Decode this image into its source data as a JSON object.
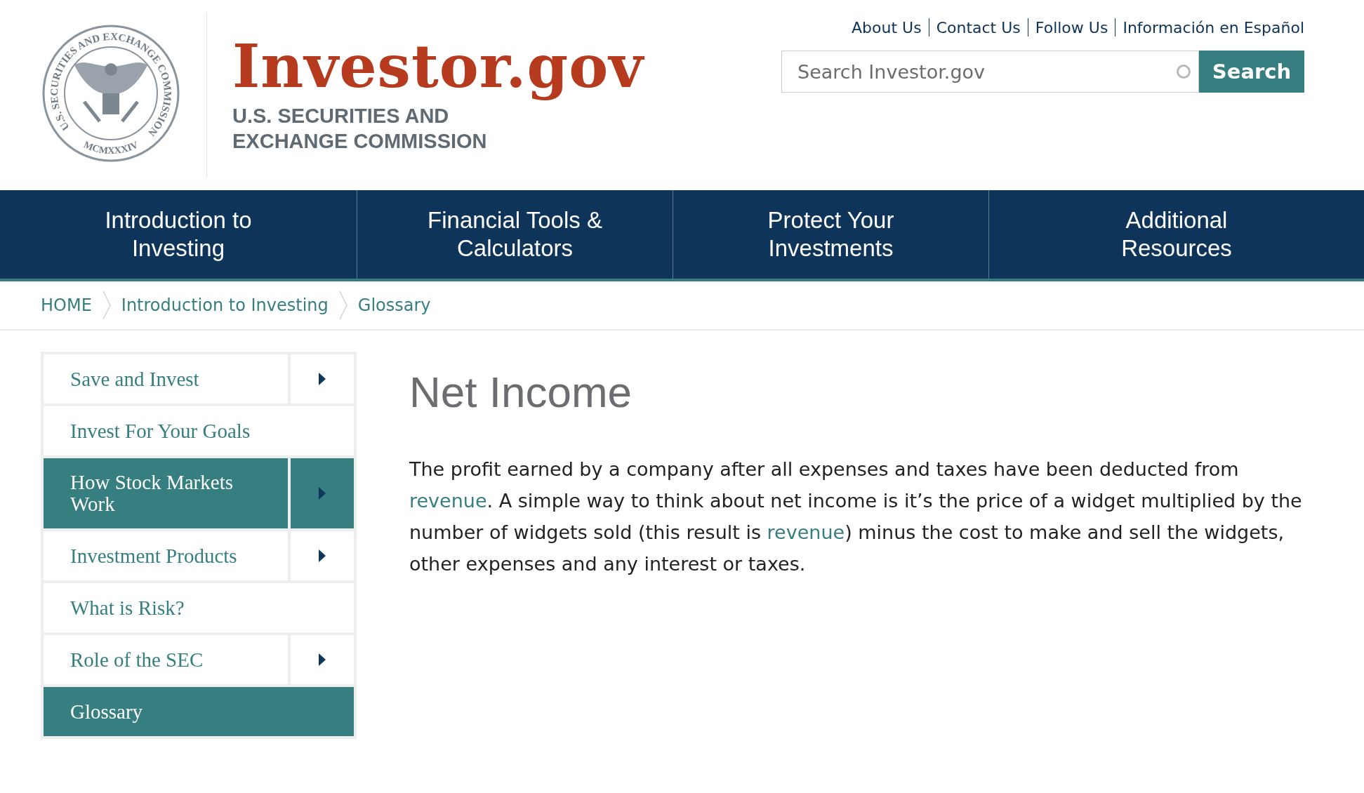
{
  "seal": {
    "ring_text": "U.S. SECURITIES AND EXCHANGE COMMISSION",
    "year": "MCMXXXIV"
  },
  "site": {
    "title": "Investor.gov",
    "subtitle_lines": [
      "U.S. SECURITIES AND",
      "EXCHANGE COMMISSION"
    ]
  },
  "utility_links": [
    "About Us",
    "Contact Us",
    "Follow Us",
    "Información en Español"
  ],
  "search": {
    "placeholder": "Search Investor.gov",
    "button": "Search"
  },
  "nav": [
    {
      "label": "Introduction to Investing"
    },
    {
      "label": "Financial Tools & Calculators"
    },
    {
      "label": "Protect Your Investments"
    },
    {
      "label": "Additional Resources"
    }
  ],
  "breadcrumb": [
    "HOME",
    "Introduction to Investing",
    "Glossary"
  ],
  "sidebar": [
    {
      "label": "Save and Invest",
      "selected": false,
      "has_submenu": true
    },
    {
      "label": "Invest For Your Goals",
      "selected": false,
      "has_submenu": false
    },
    {
      "label": "How Stock Markets Work",
      "selected": true,
      "has_submenu": true
    },
    {
      "label": "Investment Products",
      "selected": false,
      "has_submenu": true
    },
    {
      "label": "What is Risk?",
      "selected": false,
      "has_submenu": false
    },
    {
      "label": "Role of the SEC",
      "selected": false,
      "has_submenu": true
    },
    {
      "label": "Glossary",
      "selected": true,
      "has_submenu": false
    }
  ],
  "article": {
    "title": "Net Income",
    "paragraph": [
      {
        "text": "The profit earned by a company after all expenses and taxes have been deducted from ",
        "link": false
      },
      {
        "text": "revenue",
        "link": true
      },
      {
        "text": ". A simple way to think about net income is it’s the price of a widget multiplied by the number of widgets sold (this result is ",
        "link": false
      },
      {
        "text": "revenue",
        "link": true
      },
      {
        "text": ") minus the cost to make and sell the widgets, other expenses and any interest or taxes.",
        "link": false
      }
    ]
  }
}
